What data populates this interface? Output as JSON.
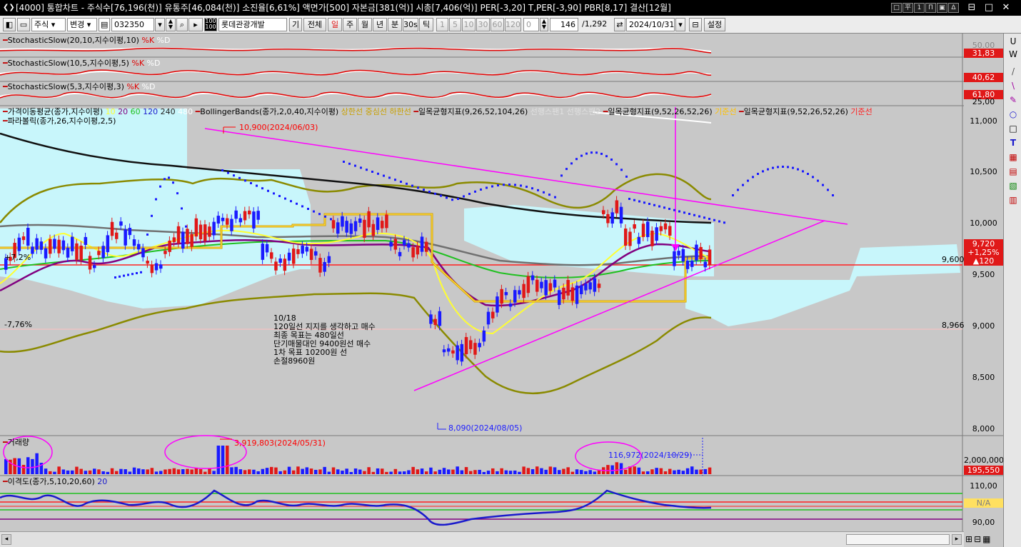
{
  "window": {
    "title": "[4000] 통합차트 - 주식수[76,196(천)] 유통주[46,084(천)] 소진율[6,61%] 액면가[500] 자본금[381(억)] 시총[7,406(억)] PER[-3,20] T,PER[-3,90] PBR[8,17] 결산[12월]",
    "right_buttons": [
      "□",
      "平",
      "1",
      "П",
      "▣",
      "Δ"
    ],
    "controls": [
      "⊟",
      "□",
      "✕"
    ]
  },
  "toolbar": {
    "market": "주식",
    "change": "변경",
    "code": "032350",
    "name": "롯데관광개발",
    "gi": "기",
    "all": "전체",
    "periods": [
      "일",
      "주",
      "월",
      "년",
      "분",
      "30s",
      "틱"
    ],
    "nums": [
      "1",
      "5",
      "10",
      "30",
      "60",
      "120"
    ],
    "zero": "0",
    "count": "146",
    "total": "/1,292",
    "date": "2024/10/31",
    "settings": "설정"
  },
  "panels": {
    "stoch1": {
      "label": "StochasticSlow(20,10,지수이평,10)",
      "k": "%K",
      "d": "%D",
      "badge": "31,83",
      "axis_top": "50.00"
    },
    "stoch2": {
      "label": "StochasticSlow(10,5,지수이평,5)",
      "k": "%K",
      "d": "%D",
      "badge": "40,62"
    },
    "stoch3": {
      "label": "StochasticSlow(5,3,지수이평,3)",
      "k": "%K",
      "d": "%D",
      "badge": "61,80",
      "axis_bottom": "25,00"
    },
    "price": {
      "legend_ma": "가격이동평균(종가,지수이평)",
      "ma_periods": [
        "10",
        "20",
        "60",
        "120",
        "240",
        "480"
      ],
      "legend_bb": "BollingerBands(종가,2,0,40,지수이평)",
      "bb_lines": [
        "상한선",
        "중심선",
        "하한선"
      ],
      "legend_ichi1": "일목균형지표(9,26,52,104,26)",
      "legend_ichi1_tail": "선행스팬1 선행스팬2",
      "legend_ichi2": "일목균형지표(9,52,26,52,26)",
      "ichi_line": "기준선",
      "legend_ichi3": "일목균형지표(9,52,26,52,26)",
      "legend_psar": "파라볼릭(종가,26,지수이평,2,5)",
      "high_label": "10,900(2024/06/03)",
      "low_label": "8,090(2024/08/05)",
      "pct_top": "+7,2%",
      "pct_bottom": "-7,76%",
      "axis": [
        "11,000",
        "10,500",
        "10,000",
        "9,500",
        "9,000",
        "8,500",
        "8,000"
      ],
      "price_badge": [
        "9,720",
        "+1,25%",
        "▲120"
      ],
      "line_9600": "9,600",
      "line_8966": "8,966",
      "note": [
        "10/18",
        "120일선 지지를 생각하고 매수",
        "최종 목표는 480일선",
        "단기매물대인 9400원선 매수",
        "1차 목표 10200원 선",
        "손절8960원"
      ]
    },
    "volume": {
      "label": "거래량",
      "peak_label": "3,919,803(2024/05/31)",
      "last_label": "116,972(2024/10/29)",
      "axis": "2,000,000",
      "badge": "195,550"
    },
    "disparity": {
      "label": "이격도(종가,5,10,20,60)",
      "num": "20",
      "axis_top": "110,00",
      "axis_bottom": "90,00",
      "badge": "N/A"
    }
  },
  "colors": {
    "up": "#e01818",
    "down": "#1a1aff",
    "cloud": "#c8f6fb",
    "magenta": "#ff00ff",
    "bg": "#c8c8c8"
  },
  "right_tools": [
    "U",
    "W",
    "/",
    "\\",
    "✎",
    "○",
    "□",
    "T",
    "▦",
    "▤",
    "▧",
    "▥"
  ]
}
